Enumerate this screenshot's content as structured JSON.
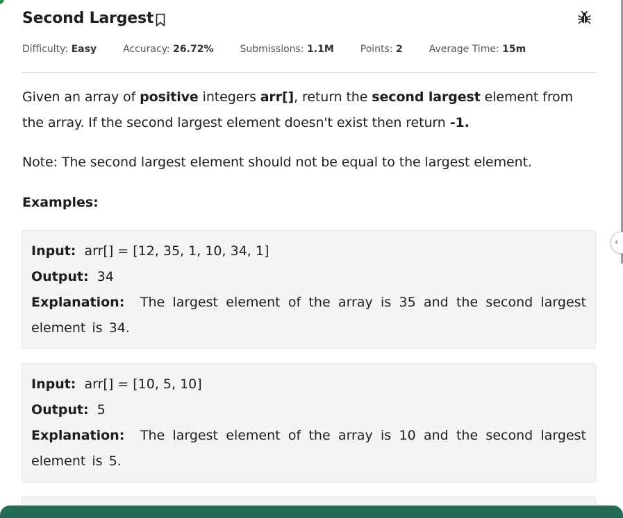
{
  "problem": {
    "title": "Second Largest",
    "meta": [
      {
        "label": "Difficulty:",
        "value": "Easy"
      },
      {
        "label": "Accuracy:",
        "value": "26.72%"
      },
      {
        "label": "Submissions:",
        "value": "1.1M"
      },
      {
        "label": "Points:",
        "value": "2"
      },
      {
        "label": "Average Time:",
        "value": "15m"
      }
    ],
    "description": {
      "t1": "Given an array of ",
      "b1": "positive",
      "t2": " integers ",
      "b2": "arr[]",
      "t3": ", return the ",
      "b3": "second largest",
      "t4": " element from the array. If the second largest element doesn't exist then return ",
      "b4": "-1."
    },
    "note": "Note: The second largest element should not be equal to the largest element.",
    "examples_heading": "Examples:",
    "examples": [
      {
        "input_label": "Input:",
        "input": "arr[] = [12, 35, 1, 10, 34, 1]",
        "output_label": "Output:",
        "output": "34",
        "explanation_label": "Explanation:",
        "explanation": "The largest element of the array is 35 and the second largest element is 34."
      },
      {
        "input_label": "Input:",
        "input": "arr[] = [10, 5, 10]",
        "output_label": "Output:",
        "output": "5",
        "explanation_label": "Explanation:",
        "explanation": "The largest element of the array is 10 and the second largest element is 5."
      }
    ]
  },
  "icons": {
    "bookmark": "bookmark-icon",
    "report": "bug-icon",
    "collapse": "chevron-left-icon"
  },
  "colors": {
    "accent": "#2f8d46",
    "bottom_bar": "#256b58",
    "example_bg": "#f4f4f4",
    "divider": "#dedede"
  }
}
